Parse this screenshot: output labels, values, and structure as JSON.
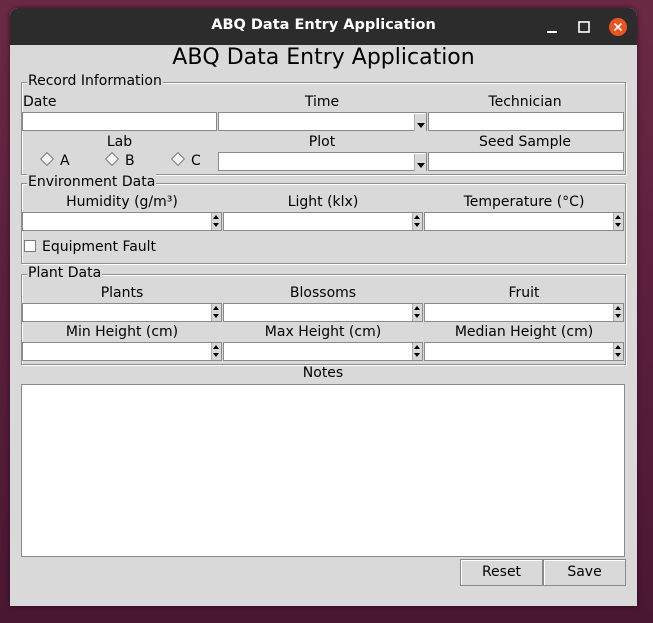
{
  "window": {
    "title": "ABQ Data Entry Application",
    "controls": [
      "minimize-icon",
      "maximize-icon",
      "close-icon"
    ],
    "close_color": "#e95420"
  },
  "app": {
    "heading": "ABQ Data Entry Application"
  },
  "record_info": {
    "legend": "Record Information",
    "date_label": "Date",
    "time_label": "Time",
    "technician_label": "Technician",
    "lab_label": "Lab",
    "plot_label": "Plot",
    "seed_sample_label": "Seed Sample",
    "lab_options": [
      "A",
      "B",
      "C"
    ],
    "date_value": "",
    "time_value": "",
    "technician_value": "",
    "plot_value": "",
    "seed_sample_value": ""
  },
  "environment": {
    "legend": "Environment Data",
    "humidity_label": "Humidity (g/m³)",
    "light_label": "Light (klx)",
    "temperature_label": "Temperature (°C)",
    "equipment_fault_label": "Equipment Fault"
  },
  "plant": {
    "legend": "Plant Data",
    "plants_label": "Plants",
    "blossoms_label": "Blossoms",
    "fruit_label": "Fruit",
    "min_height_label": "Min Height (cm)",
    "max_height_label": "Max Height (cm)",
    "median_height_label": "Median Height (cm)"
  },
  "notes": {
    "label": "Notes",
    "value": ""
  },
  "buttons": {
    "reset": "Reset",
    "save": "Save"
  }
}
